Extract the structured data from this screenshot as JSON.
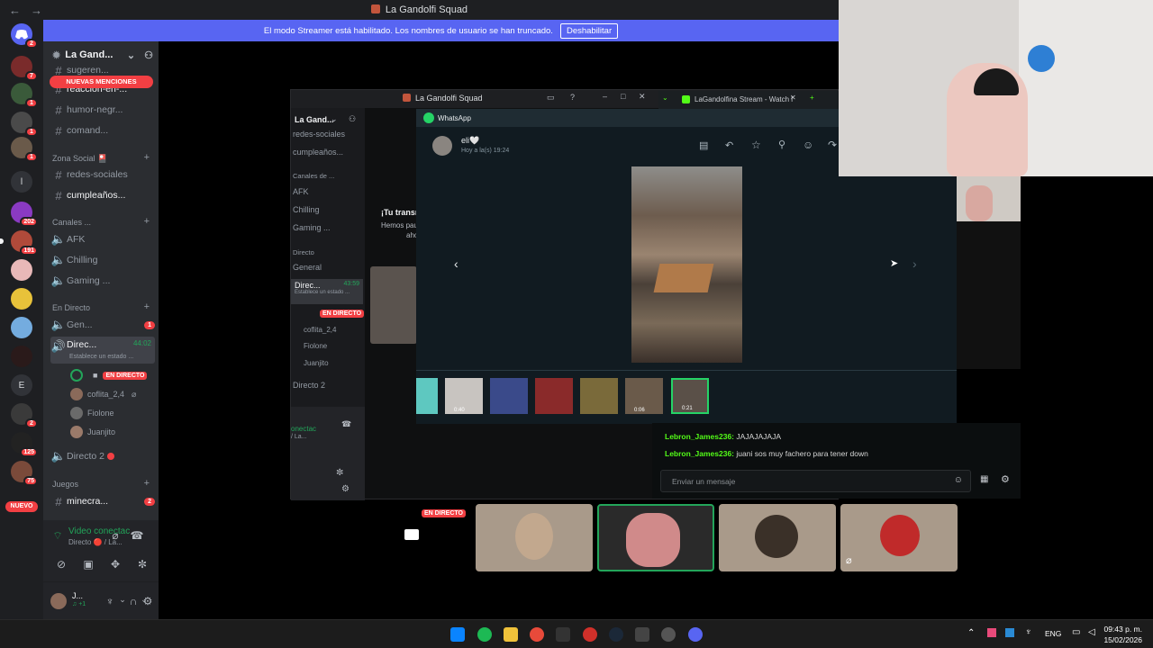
{
  "window": {
    "title": "La Gandolfi Squad",
    "back": "←",
    "forward": "→"
  },
  "banner": {
    "text": "El modo Streamer está habilitado. Los nombres de usuario se han truncado.",
    "button": "Deshabilitar"
  },
  "rail": {
    "badges": [
      "2",
      "7",
      "1",
      "1",
      "1",
      "202",
      "191",
      "2",
      "125",
      "75"
    ],
    "letter_l": "l",
    "letter_e": "E",
    "nuevo": "NUEVO"
  },
  "sidebar": {
    "server_name": "La Gand...",
    "mentions_pill": "NUEVAS MENCIONES",
    "channels_top": [
      "sugeren...",
      "reacción-en-...",
      "humor-negr...",
      "comand..."
    ],
    "zona_social": "Zona Social 🎴",
    "redes": "redes-sociales",
    "cumple": "cumpleaños...",
    "voice_cat": "Canales ...",
    "afk": "AFK",
    "chilling": "Chilling",
    "gaming": "Gaming ...",
    "en_directo_cat": "En Directo",
    "general": "Gen...",
    "general_badge": "1",
    "directo": "Direc...",
    "directo_time": "44:02",
    "directo_status": "Establece un estado ...",
    "live_tag": "EN DIRECTO",
    "users": [
      "coflita_2,4",
      "Fiolone",
      "Juanjito"
    ],
    "directo2": "Directo 2",
    "juegos_cat": "Juegos",
    "minecra": "minecra...",
    "minecra_badge": "2",
    "video_status": "Video conectac",
    "video_sub": "Directo 🔴 / La...",
    "user_name": "J...",
    "user_sub": "♫ +1"
  },
  "inner": {
    "title": "La Gandolfi Squad",
    "server": "La Gand...",
    "channels": [
      "redes-sociales",
      "cumpleaños...",
      "Canales de ...",
      "AFK",
      "Chilling",
      "Gaming ...",
      "Directo",
      "General",
      "Direc...",
      "EN DIRECTO",
      "coflita_2,4",
      "Fiolone",
      "Juanjito",
      "Directo 2"
    ],
    "dir_time": "43:59",
    "dir_status": "Establece un estado ...",
    "tu_trans": "¡Tu transm",
    "hemos": "Hemos pau",
    "ahora": "aho",
    "conect": "onectac",
    "conect_sub": "/ La..."
  },
  "whatsapp": {
    "app": "WhatsApp",
    "sender": "eli🤍",
    "time": "Hoy a la(s) 19:24",
    "thumb_times": [
      "0:40",
      "0:06",
      "0:21"
    ]
  },
  "kick": {
    "tab": "LaGandolfina Stream - Watch l",
    "lines": [
      {
        "user": "Lebron_James236:",
        "msg": "JAJAJAJAJA"
      },
      {
        "user": "Lebron_James236:",
        "msg": "juani sos muy fachero para tener down"
      }
    ],
    "placeholder": "Enviar un mensaje"
  },
  "tiles": {
    "live_tag": "EN DIRECTO"
  },
  "taskbar": {
    "lang": "ENG",
    "time": "09:43 p. m.",
    "date": "15/02/2026"
  },
  "colors": {
    "blurple": "#5865f2",
    "red": "#f23f43",
    "green": "#23a55a",
    "kick_green": "#53fc18",
    "wa_green": "#25d366"
  }
}
